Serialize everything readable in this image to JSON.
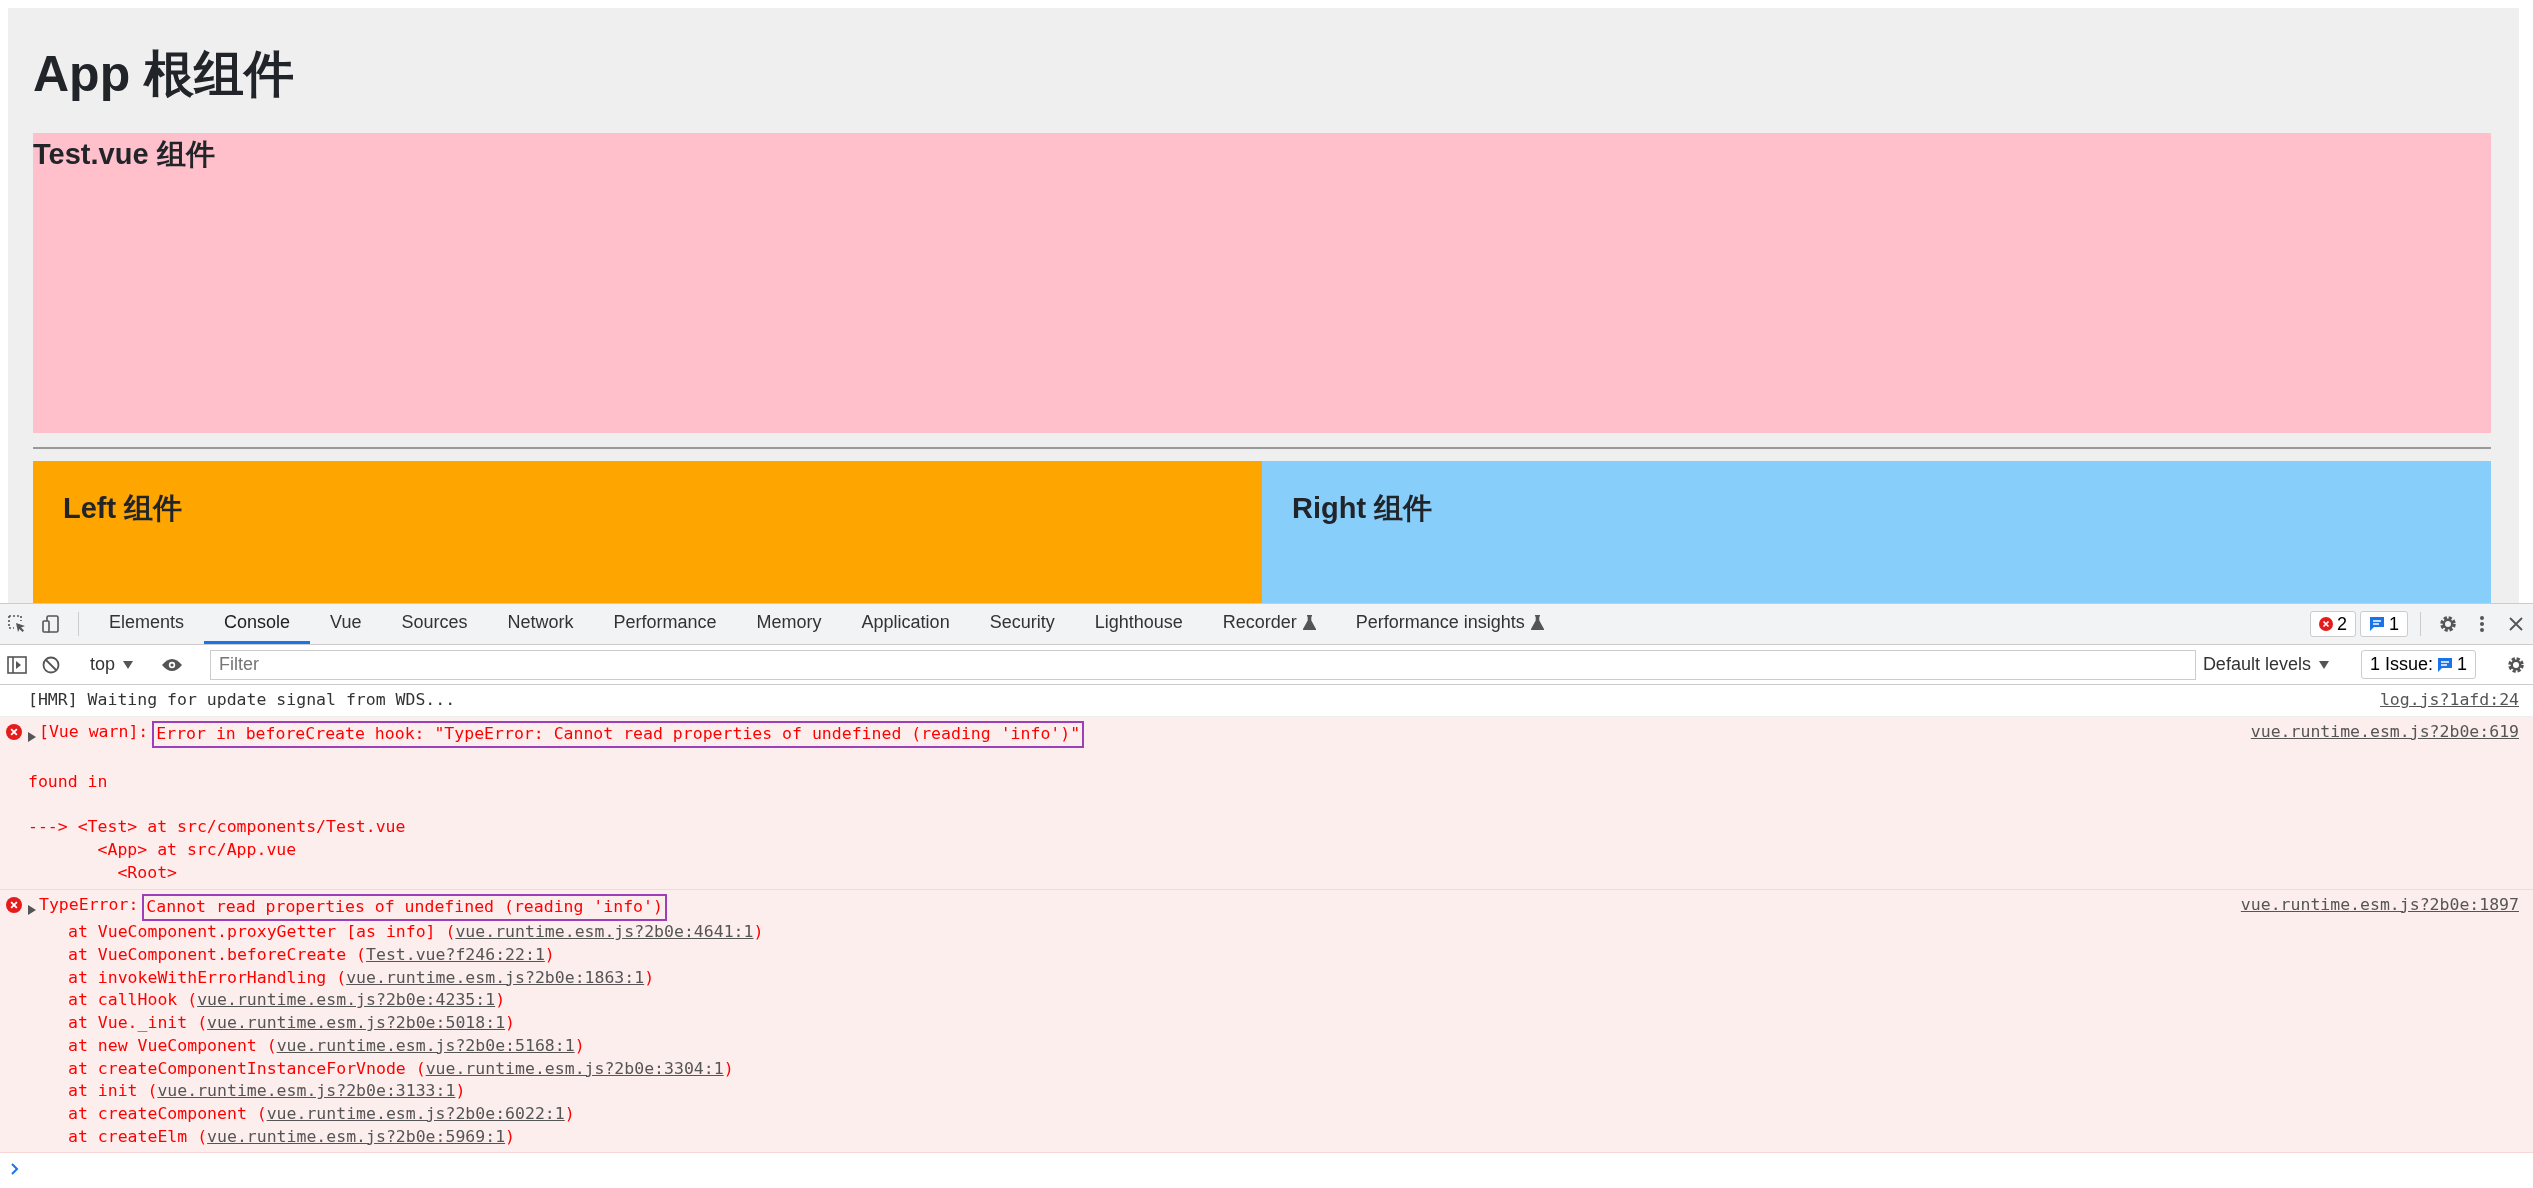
{
  "page": {
    "title": "App 根组件",
    "test_component": {
      "title": "Test.vue 组件"
    },
    "left_component": {
      "title": "Left 组件"
    },
    "right_component": {
      "title": "Right 组件"
    }
  },
  "devtools": {
    "tabs": [
      {
        "label": "Elements",
        "selected": false,
        "experimental": false
      },
      {
        "label": "Console",
        "selected": true,
        "experimental": false
      },
      {
        "label": "Vue",
        "selected": false,
        "experimental": false
      },
      {
        "label": "Sources",
        "selected": false,
        "experimental": false
      },
      {
        "label": "Network",
        "selected": false,
        "experimental": false
      },
      {
        "label": "Performance",
        "selected": false,
        "experimental": false
      },
      {
        "label": "Memory",
        "selected": false,
        "experimental": false
      },
      {
        "label": "Application",
        "selected": false,
        "experimental": false
      },
      {
        "label": "Security",
        "selected": false,
        "experimental": false
      },
      {
        "label": "Lighthouse",
        "selected": false,
        "experimental": false
      },
      {
        "label": "Recorder",
        "selected": false,
        "experimental": true
      },
      {
        "label": "Performance insights",
        "selected": false,
        "experimental": true
      }
    ],
    "error_count": "2",
    "message_count": "1",
    "context": "top",
    "filter_placeholder": "Filter",
    "levels": "Default levels",
    "issues_label": "1 Issue:",
    "issues_count": "1"
  },
  "console": {
    "messages": [
      {
        "kind": "log",
        "text": "[HMR] Waiting for update signal from WDS...",
        "source": "log.js?1afd:24"
      },
      {
        "kind": "error",
        "prefix": "[Vue warn]:",
        "text": "Error in beforeCreate hook: \"TypeError: Cannot read properties of undefined (reading 'info')\"",
        "highlighted": true,
        "source": "vue.runtime.esm.js?2b0e:619",
        "found_in": "found in",
        "trace": [
          {
            "text": "---> <Test> at src/components/Test.vue",
            "children": [
              {
                "text": "<App> at src/App.vue",
                "children": [
                  {
                    "text": "<Root>"
                  }
                ]
              }
            ]
          }
        ]
      },
      {
        "kind": "error",
        "prefix": "TypeError:",
        "text": "Cannot read properties of undefined (reading 'info')",
        "highlighted": true,
        "source": "vue.runtime.esm.js?2b0e:1897",
        "stack": [
          {
            "call": "at VueComponent.proxyGetter [as info] (",
            "link": "vue.runtime.esm.js?2b0e:4641:1",
            "tail": ")"
          },
          {
            "call": "at VueComponent.beforeCreate (",
            "link": "Test.vue?f246:22:1",
            "tail": ")"
          },
          {
            "call": "at invokeWithErrorHandling (",
            "link": "vue.runtime.esm.js?2b0e:1863:1",
            "tail": ")"
          },
          {
            "call": "at callHook (",
            "link": "vue.runtime.esm.js?2b0e:4235:1",
            "tail": ")"
          },
          {
            "call": "at Vue._init (",
            "link": "vue.runtime.esm.js?2b0e:5018:1",
            "tail": ")"
          },
          {
            "call": "at new VueComponent (",
            "link": "vue.runtime.esm.js?2b0e:5168:1",
            "tail": ")"
          },
          {
            "call": "at createComponentInstanceForVnode (",
            "link": "vue.runtime.esm.js?2b0e:3304:1",
            "tail": ")"
          },
          {
            "call": "at init (",
            "link": "vue.runtime.esm.js?2b0e:3133:1",
            "tail": ")"
          },
          {
            "call": "at createComponent (",
            "link": "vue.runtime.esm.js?2b0e:6022:1",
            "tail": ")"
          },
          {
            "call": "at createElm (",
            "link": "vue.runtime.esm.js?2b0e:5969:1",
            "tail": ")"
          }
        ]
      }
    ]
  }
}
